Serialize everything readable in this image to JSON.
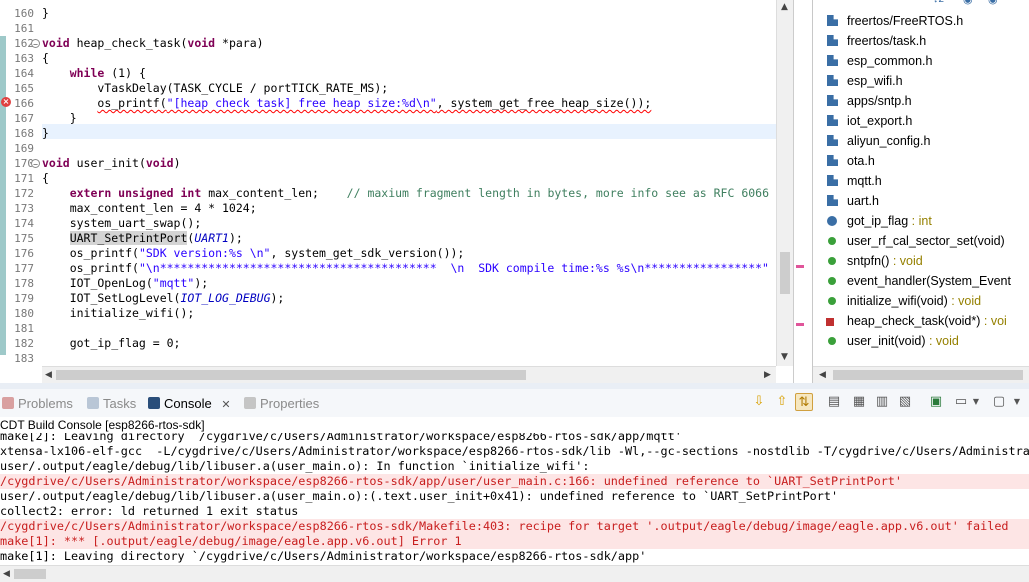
{
  "editor": {
    "lines": [
      {
        "num": "160",
        "code": "}"
      },
      {
        "num": "161",
        "code": ""
      },
      {
        "num": "162",
        "parts": [
          [
            "kw",
            "void"
          ],
          [
            "",
            " heap_check_task("
          ],
          [
            "kw",
            "void"
          ],
          [
            "",
            " *para)"
          ]
        ]
      },
      {
        "num": "163",
        "code": "{"
      },
      {
        "num": "164",
        "parts": [
          [
            "",
            "    "
          ],
          [
            "kw",
            "while"
          ],
          [
            "",
            " (1) {"
          ]
        ]
      },
      {
        "num": "165",
        "code": "        vTaskDelay(TASK_CYCLE / portTICK_RATE_MS);"
      },
      {
        "num": "166",
        "parts": [
          [
            "",
            "        "
          ],
          [
            "squig",
            "os_printf("
          ],
          [
            "squigstr",
            "\"[heap check task] free heap size:%d\\n\""
          ],
          [
            "squig",
            ", system_get_free_heap_size());"
          ]
        ]
      },
      {
        "num": "167",
        "code": "    }"
      },
      {
        "num": "168",
        "code": "}"
      },
      {
        "num": "169",
        "code": ""
      },
      {
        "num": "170",
        "parts": [
          [
            "kw",
            "void"
          ],
          [
            "",
            " user_init("
          ],
          [
            "kw",
            "void"
          ],
          [
            "",
            ")"
          ]
        ]
      },
      {
        "num": "171",
        "code": "{"
      },
      {
        "num": "172",
        "parts": [
          [
            "",
            "    "
          ],
          [
            "kw",
            "extern unsigned int"
          ],
          [
            "",
            " max_content_len;    "
          ],
          [
            "cmt",
            "// maxium fragment length in bytes, more info see as RFC 6066"
          ]
        ]
      },
      {
        "num": "173",
        "code": "    max_content_len = 4 * 1024;"
      },
      {
        "num": "174",
        "code": "    system_uart_swap();"
      },
      {
        "num": "175",
        "parts": [
          [
            "",
            "    "
          ],
          [
            "hl",
            "UART_SetPrintPort"
          ],
          [
            "",
            "("
          ],
          [
            "it",
            "UART1"
          ],
          [
            "",
            ");"
          ]
        ]
      },
      {
        "num": "176",
        "parts": [
          [
            "",
            "    os_printf("
          ],
          [
            "str",
            "\"SDK version:%s \\n\""
          ],
          [
            "",
            ", system_get_sdk_version());"
          ]
        ]
      },
      {
        "num": "177",
        "parts": [
          [
            "",
            "    os_printf("
          ],
          [
            "str",
            "\"\\n****************************************  \\n  SDK compile time:%s %s\\n*****************\""
          ]
        ]
      },
      {
        "num": "178",
        "parts": [
          [
            "",
            "    IOT_OpenLog("
          ],
          [
            "str",
            "\"mqtt\""
          ],
          [
            "",
            ");"
          ]
        ]
      },
      {
        "num": "179",
        "parts": [
          [
            "",
            "    IOT_SetLogLevel("
          ],
          [
            "it",
            "IOT_LOG_DEBUG"
          ],
          [
            "",
            ");"
          ]
        ]
      },
      {
        "num": "180",
        "code": "    initialize_wifi();"
      },
      {
        "num": "181",
        "code": ""
      },
      {
        "num": "182",
        "code": "    got_ip_flag = 0;"
      },
      {
        "num": "183",
        "code": ""
      }
    ]
  },
  "outline": {
    "items": [
      {
        "label": "freertos/FreeRTOS.h",
        "type": "",
        "kind": "header"
      },
      {
        "label": "freertos/task.h",
        "type": "",
        "kind": "header"
      },
      {
        "label": "esp_common.h",
        "type": "",
        "kind": "header"
      },
      {
        "label": "esp_wifi.h",
        "type": "",
        "kind": "header"
      },
      {
        "label": "apps/sntp.h",
        "type": "",
        "kind": "header"
      },
      {
        "label": "iot_export.h",
        "type": "",
        "kind": "header"
      },
      {
        "label": "aliyun_config.h",
        "type": "",
        "kind": "header"
      },
      {
        "label": "ota.h",
        "type": "",
        "kind": "header"
      },
      {
        "label": "mqtt.h",
        "type": "",
        "kind": "header"
      },
      {
        "label": "uart.h",
        "type": "",
        "kind": "header"
      },
      {
        "label": "got_ip_flag",
        "type": " : int",
        "kind": "var"
      },
      {
        "label": "user_rf_cal_sector_set(void)",
        "type": "",
        "kind": "fn"
      },
      {
        "label": "sntpfn()",
        "type": " : void",
        "kind": "fn"
      },
      {
        "label": "event_handler(System_Event",
        "type": "",
        "kind": "fn"
      },
      {
        "label": "initialize_wifi(void)",
        "type": " : void",
        "kind": "fn"
      },
      {
        "label": "heap_check_task(void*)",
        "type": " : voi",
        "kind": "fnerr"
      },
      {
        "label": "user_init(void)",
        "type": " : void",
        "kind": "fn"
      }
    ]
  },
  "tabs": [
    {
      "label": "Problems",
      "active": false
    },
    {
      "label": "Tasks",
      "active": false
    },
    {
      "label": "Console",
      "active": true
    },
    {
      "label": "Properties",
      "active": false
    }
  ],
  "console": {
    "title": "CDT Build Console [esp8266-rtos-sdk]",
    "lines": [
      {
        "text": "make[2]: Leaving directory `/cygdrive/c/Users/Administrator/workspace/esp8266-rtos-sdk/app/mqtt'",
        "error": false
      },
      {
        "text": "xtensa-lx106-elf-gcc  -L/cygdrive/c/Users/Administrator/workspace/esp8266-rtos-sdk/lib -Wl,--gc-sections -nostdlib -T/cygdrive/c/Users/Administrato",
        "error": false
      },
      {
        "text": "user/.output/eagle/debug/lib/libuser.a(user_main.o): In function `initialize_wifi':",
        "error": false
      },
      {
        "text": "/cygdrive/c/Users/Administrator/workspace/esp8266-rtos-sdk/app/user/user_main.c:166: undefined reference to `UART_SetPrintPort'",
        "error": true
      },
      {
        "text": "user/.output/eagle/debug/lib/libuser.a(user_main.o):(.text.user_init+0x41): undefined reference to `UART_SetPrintPort'",
        "error": false
      },
      {
        "text": "collect2: error: ld returned 1 exit status",
        "error": false
      },
      {
        "text": "/cygdrive/c/Users/Administrator/workspace/esp8266-rtos-sdk/Makefile:403: recipe for target '.output/eagle/debug/image/eagle.app.v6.out' failed",
        "error": true
      },
      {
        "text": "make[1]: *** [.output/eagle/debug/image/eagle.app.v6.out] Error 1",
        "error": true
      },
      {
        "text": "make[1]: Leaving directory `/cygdrive/c/Users/Administrator/workspace/esp8266-rtos-sdk/app'",
        "error": false
      }
    ]
  }
}
